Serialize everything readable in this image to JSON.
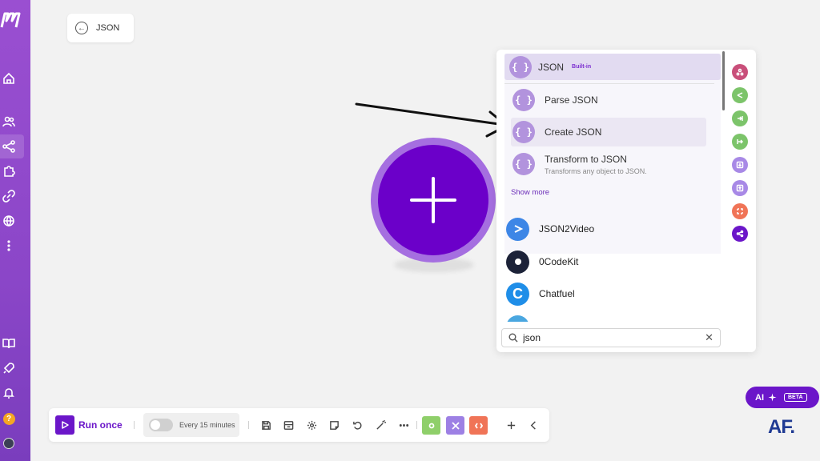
{
  "header": {
    "back_label": "JSON"
  },
  "panel": {
    "group": {
      "name": "JSON",
      "badge": "Built-in",
      "icon": "json-bracket-icon"
    },
    "actions": [
      {
        "label": "Parse JSON",
        "desc": ""
      },
      {
        "label": "Create JSON",
        "desc": ""
      },
      {
        "label": "Transform to JSON",
        "desc": "Transforms any object to JSON."
      }
    ],
    "show_more": "Show more",
    "apps": [
      {
        "label": "JSON2Video",
        "color": "#3d86e6"
      },
      {
        "label": "0CodeKit",
        "color": "#1c2238"
      },
      {
        "label": "Chatfuel",
        "color": "#1f8ee8"
      },
      {
        "label": "",
        "color": "#4aa7e0"
      }
    ],
    "search": {
      "value": "json",
      "placeholder": ""
    }
  },
  "toolbar": {
    "run_label": "Run once",
    "schedule_label": "Every 15 minutes"
  },
  "ai": {
    "label": "AI",
    "badge": "BETA"
  },
  "watermark": "AF.",
  "colors": {
    "accent": "#6b16c9",
    "module_core": "#6b00c9",
    "module_ring": "#a56fe0",
    "rail": [
      "#c94f7a",
      "#7cc46a",
      "#7cc46a",
      "#7cc46a",
      "#a889e6",
      "#a889e6",
      "#f07457",
      "#6b16c9"
    ],
    "toolbar_tiles": [
      "#8fcf6a",
      "#9d80e4",
      "#f07457"
    ]
  }
}
